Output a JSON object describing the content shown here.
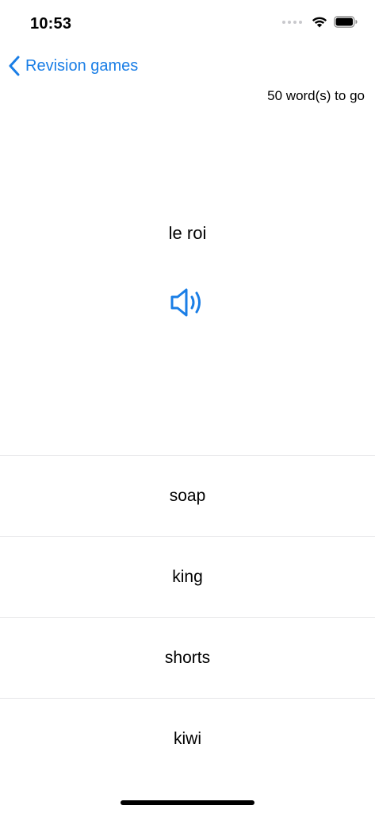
{
  "status": {
    "time": "10:53"
  },
  "nav": {
    "back_label": "Revision games"
  },
  "progress": {
    "remaining_text": "50 word(s) to go"
  },
  "question": {
    "word": "le roi",
    "audio_icon": "speaker-icon"
  },
  "answers": [
    {
      "label": "soap"
    },
    {
      "label": "king"
    },
    {
      "label": "shorts"
    },
    {
      "label": "kiwi"
    }
  ],
  "colors": {
    "accent": "#1a7ee6",
    "divider": "#e6e6e8"
  }
}
